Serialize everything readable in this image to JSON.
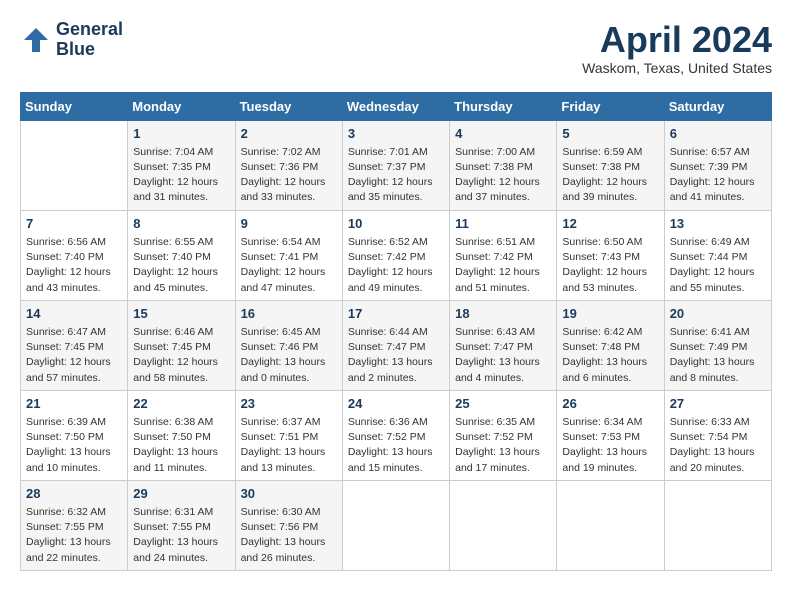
{
  "header": {
    "logo_line1": "General",
    "logo_line2": "Blue",
    "month": "April 2024",
    "location": "Waskom, Texas, United States"
  },
  "days_of_week": [
    "Sunday",
    "Monday",
    "Tuesday",
    "Wednesday",
    "Thursday",
    "Friday",
    "Saturday"
  ],
  "weeks": [
    [
      {
        "day": "",
        "sunrise": "",
        "sunset": "",
        "daylight": ""
      },
      {
        "day": "1",
        "sunrise": "Sunrise: 7:04 AM",
        "sunset": "Sunset: 7:35 PM",
        "daylight": "Daylight: 12 hours and 31 minutes."
      },
      {
        "day": "2",
        "sunrise": "Sunrise: 7:02 AM",
        "sunset": "Sunset: 7:36 PM",
        "daylight": "Daylight: 12 hours and 33 minutes."
      },
      {
        "day": "3",
        "sunrise": "Sunrise: 7:01 AM",
        "sunset": "Sunset: 7:37 PM",
        "daylight": "Daylight: 12 hours and 35 minutes."
      },
      {
        "day": "4",
        "sunrise": "Sunrise: 7:00 AM",
        "sunset": "Sunset: 7:38 PM",
        "daylight": "Daylight: 12 hours and 37 minutes."
      },
      {
        "day": "5",
        "sunrise": "Sunrise: 6:59 AM",
        "sunset": "Sunset: 7:38 PM",
        "daylight": "Daylight: 12 hours and 39 minutes."
      },
      {
        "day": "6",
        "sunrise": "Sunrise: 6:57 AM",
        "sunset": "Sunset: 7:39 PM",
        "daylight": "Daylight: 12 hours and 41 minutes."
      }
    ],
    [
      {
        "day": "7",
        "sunrise": "Sunrise: 6:56 AM",
        "sunset": "Sunset: 7:40 PM",
        "daylight": "Daylight: 12 hours and 43 minutes."
      },
      {
        "day": "8",
        "sunrise": "Sunrise: 6:55 AM",
        "sunset": "Sunset: 7:40 PM",
        "daylight": "Daylight: 12 hours and 45 minutes."
      },
      {
        "day": "9",
        "sunrise": "Sunrise: 6:54 AM",
        "sunset": "Sunset: 7:41 PM",
        "daylight": "Daylight: 12 hours and 47 minutes."
      },
      {
        "day": "10",
        "sunrise": "Sunrise: 6:52 AM",
        "sunset": "Sunset: 7:42 PM",
        "daylight": "Daylight: 12 hours and 49 minutes."
      },
      {
        "day": "11",
        "sunrise": "Sunrise: 6:51 AM",
        "sunset": "Sunset: 7:42 PM",
        "daylight": "Daylight: 12 hours and 51 minutes."
      },
      {
        "day": "12",
        "sunrise": "Sunrise: 6:50 AM",
        "sunset": "Sunset: 7:43 PM",
        "daylight": "Daylight: 12 hours and 53 minutes."
      },
      {
        "day": "13",
        "sunrise": "Sunrise: 6:49 AM",
        "sunset": "Sunset: 7:44 PM",
        "daylight": "Daylight: 12 hours and 55 minutes."
      }
    ],
    [
      {
        "day": "14",
        "sunrise": "Sunrise: 6:47 AM",
        "sunset": "Sunset: 7:45 PM",
        "daylight": "Daylight: 12 hours and 57 minutes."
      },
      {
        "day": "15",
        "sunrise": "Sunrise: 6:46 AM",
        "sunset": "Sunset: 7:45 PM",
        "daylight": "Daylight: 12 hours and 58 minutes."
      },
      {
        "day": "16",
        "sunrise": "Sunrise: 6:45 AM",
        "sunset": "Sunset: 7:46 PM",
        "daylight": "Daylight: 13 hours and 0 minutes."
      },
      {
        "day": "17",
        "sunrise": "Sunrise: 6:44 AM",
        "sunset": "Sunset: 7:47 PM",
        "daylight": "Daylight: 13 hours and 2 minutes."
      },
      {
        "day": "18",
        "sunrise": "Sunrise: 6:43 AM",
        "sunset": "Sunset: 7:47 PM",
        "daylight": "Daylight: 13 hours and 4 minutes."
      },
      {
        "day": "19",
        "sunrise": "Sunrise: 6:42 AM",
        "sunset": "Sunset: 7:48 PM",
        "daylight": "Daylight: 13 hours and 6 minutes."
      },
      {
        "day": "20",
        "sunrise": "Sunrise: 6:41 AM",
        "sunset": "Sunset: 7:49 PM",
        "daylight": "Daylight: 13 hours and 8 minutes."
      }
    ],
    [
      {
        "day": "21",
        "sunrise": "Sunrise: 6:39 AM",
        "sunset": "Sunset: 7:50 PM",
        "daylight": "Daylight: 13 hours and 10 minutes."
      },
      {
        "day": "22",
        "sunrise": "Sunrise: 6:38 AM",
        "sunset": "Sunset: 7:50 PM",
        "daylight": "Daylight: 13 hours and 11 minutes."
      },
      {
        "day": "23",
        "sunrise": "Sunrise: 6:37 AM",
        "sunset": "Sunset: 7:51 PM",
        "daylight": "Daylight: 13 hours and 13 minutes."
      },
      {
        "day": "24",
        "sunrise": "Sunrise: 6:36 AM",
        "sunset": "Sunset: 7:52 PM",
        "daylight": "Daylight: 13 hours and 15 minutes."
      },
      {
        "day": "25",
        "sunrise": "Sunrise: 6:35 AM",
        "sunset": "Sunset: 7:52 PM",
        "daylight": "Daylight: 13 hours and 17 minutes."
      },
      {
        "day": "26",
        "sunrise": "Sunrise: 6:34 AM",
        "sunset": "Sunset: 7:53 PM",
        "daylight": "Daylight: 13 hours and 19 minutes."
      },
      {
        "day": "27",
        "sunrise": "Sunrise: 6:33 AM",
        "sunset": "Sunset: 7:54 PM",
        "daylight": "Daylight: 13 hours and 20 minutes."
      }
    ],
    [
      {
        "day": "28",
        "sunrise": "Sunrise: 6:32 AM",
        "sunset": "Sunset: 7:55 PM",
        "daylight": "Daylight: 13 hours and 22 minutes."
      },
      {
        "day": "29",
        "sunrise": "Sunrise: 6:31 AM",
        "sunset": "Sunset: 7:55 PM",
        "daylight": "Daylight: 13 hours and 24 minutes."
      },
      {
        "day": "30",
        "sunrise": "Sunrise: 6:30 AM",
        "sunset": "Sunset: 7:56 PM",
        "daylight": "Daylight: 13 hours and 26 minutes."
      },
      {
        "day": "",
        "sunrise": "",
        "sunset": "",
        "daylight": ""
      },
      {
        "day": "",
        "sunrise": "",
        "sunset": "",
        "daylight": ""
      },
      {
        "day": "",
        "sunrise": "",
        "sunset": "",
        "daylight": ""
      },
      {
        "day": "",
        "sunrise": "",
        "sunset": "",
        "daylight": ""
      }
    ]
  ]
}
